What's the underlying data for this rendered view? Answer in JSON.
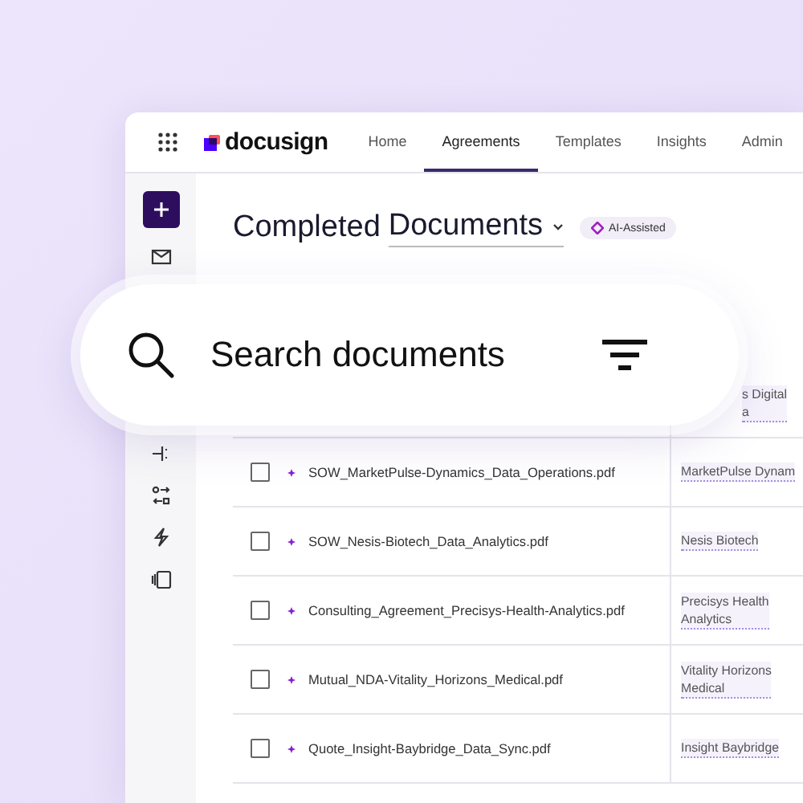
{
  "header": {
    "logo": "docusign",
    "tabs": [
      {
        "label": "Home",
        "selected": false
      },
      {
        "label": "Agreements",
        "selected": true
      },
      {
        "label": "Templates",
        "selected": false
      },
      {
        "label": "Insights",
        "selected": false
      },
      {
        "label": "Admin",
        "selected": false
      }
    ]
  },
  "title": {
    "prefix": "Completed",
    "view": "Documents",
    "badge": "AI-Assisted"
  },
  "search": {
    "placeholder": "Search documents"
  },
  "table": {
    "rows": [
      {
        "counterparty": [
          "s Digital",
          "a"
        ]
      },
      {
        "file": "SOW_MarketPulse-Dynamics_Data_Operations.pdf",
        "checked": false,
        "counterparty": [
          "MarketPulse Dynam"
        ]
      },
      {
        "file": "SOW_Nesis-Biotech_Data_Analytics.pdf",
        "checked": false,
        "counterparty": [
          "Nesis Biotech"
        ]
      },
      {
        "file": "Consulting_Agreement_Precisys-Health-Analytics.pdf",
        "checked": false,
        "counterparty": [
          "Precisys Health",
          "Analytics"
        ]
      },
      {
        "file": "Mutual_NDA-Vitality_Horizons_Medical.pdf",
        "checked": false,
        "counterparty": [
          "Vitality Horizons",
          "Medical"
        ]
      },
      {
        "file": "Quote_Insight-Baybridge_Data_Sync.pdf",
        "checked": false,
        "counterparty": [
          "Insight Baybridge"
        ]
      }
    ]
  }
}
